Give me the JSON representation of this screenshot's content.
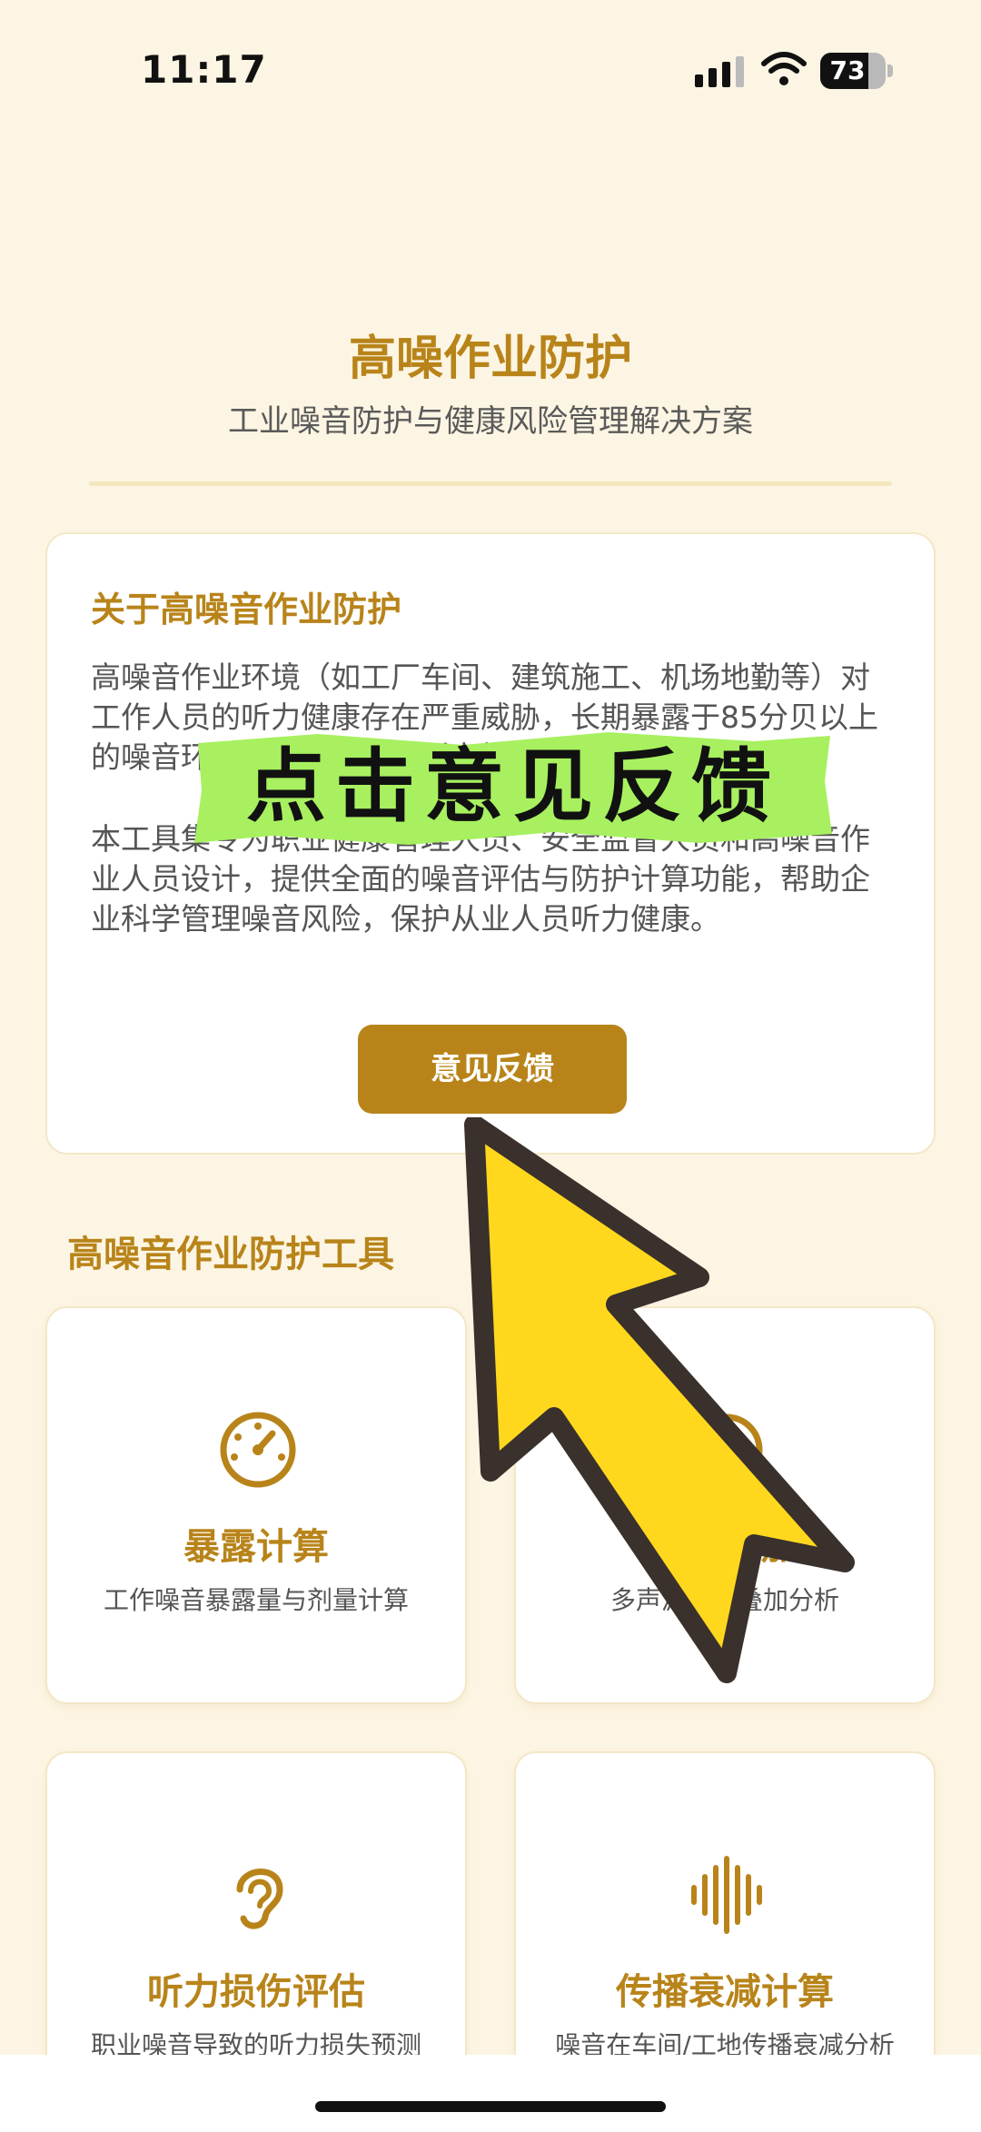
{
  "status_bar": {
    "time": "11:17",
    "battery": "73",
    "battery_level": 0.73
  },
  "header": {
    "title": "高噪作业防护",
    "subtitle": "工业噪音防护与健康风险管理解决方案"
  },
  "about": {
    "title": "关于高噪音作业防护",
    "paragraph1": "高噪音作业环境（如工厂车间、建筑施工、机场地勤等）对工作人员的听力健康存在严重威胁，长期暴露于85分贝以上的噪音环境可导致永久性听力损伤。",
    "paragraph2": "本工具集专为职业健康管理人员、安全监督人员和高噪音作业人员设计，提供全面的噪音评估与防护计算功能，帮助企业科学管理噪音风险，保护从业人员听力健康。",
    "feedback_button": "意见反馈"
  },
  "tools_section": {
    "title": "高噪音作业防护工具",
    "items": [
      {
        "name": "暴露计算",
        "desc": "工作噪音暴露量与剂量计算",
        "icon": "gauge-icon"
      },
      {
        "name": "噪音叠加",
        "desc": "多声源噪音叠加分析",
        "icon": "layers-icon"
      },
      {
        "name": "听力损伤评估",
        "desc": "职业噪音导致的听力损失预测",
        "icon": "ear-icon"
      },
      {
        "name": "传播衰减计算",
        "desc": "噪音在车间/工地传播衰减分析",
        "icon": "soundwave-icon"
      }
    ]
  },
  "overlay": {
    "banner_text": "点击意见反馈"
  },
  "colors": {
    "accent": "#b8841a",
    "background": "#fdf5e3",
    "banner": "#a8f060",
    "arrow": "#ffd81e"
  }
}
